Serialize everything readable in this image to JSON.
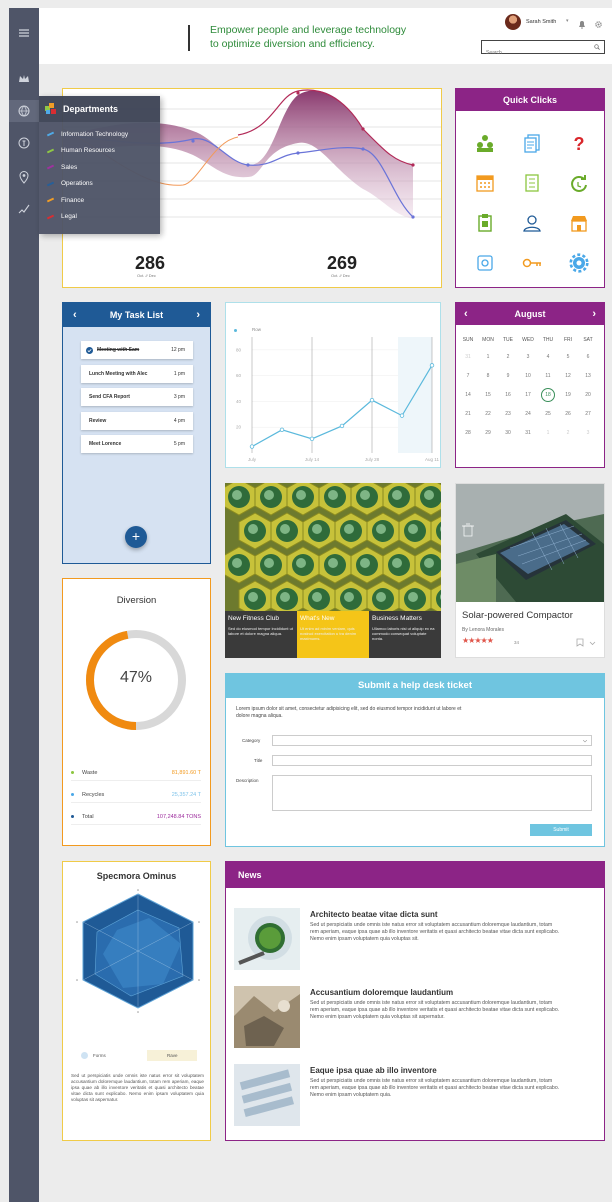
{
  "header": {
    "tagline_line1": "Empower people and leverage technology",
    "tagline_line2": "to optimize diversion and efficiency.",
    "user_name": "Sarah Smith",
    "user_caret": "▾",
    "search_placeholder": "Search"
  },
  "departments": {
    "title": "Departments",
    "items": [
      {
        "label": "Information Technology",
        "color": "#4aa8e8"
      },
      {
        "label": "Human Resources",
        "color": "#8cc63f"
      },
      {
        "label": "Sales",
        "color": "#9c2a9c"
      },
      {
        "label": "Operations",
        "color": "#1f5a96"
      },
      {
        "label": "Finance",
        "color": "#f29a1f"
      },
      {
        "label": "Legal",
        "color": "#d9262b"
      }
    ]
  },
  "top_chart": {
    "stat1_value": "286",
    "stat1_label": "Oct. // Dec",
    "stat2_value": "269",
    "stat2_label": "Oct. // Dec"
  },
  "quick_clicks": {
    "title": "Quick Clicks",
    "icons": [
      "people-icon",
      "document-icon",
      "help-icon",
      "calendar-icon",
      "checklist-icon",
      "refresh-icon",
      "clipboard-icon",
      "user-icon",
      "store-icon",
      "square-icon",
      "key-icon",
      "gear-icon"
    ]
  },
  "tasks": {
    "title": "My Task List",
    "prev": "‹",
    "next": "›",
    "items": [
      {
        "label": "Meeting with Sam",
        "time": "12 pm",
        "done": true
      },
      {
        "label": "Lunch Meeting with Alec",
        "time": "1 pm",
        "done": false
      },
      {
        "label": "Send CFA Report",
        "time": "3 pm",
        "done": false
      },
      {
        "label": "Review",
        "time": "4 pm",
        "done": false
      },
      {
        "label": "Meet Lorence",
        "time": "5 pm",
        "done": false
      }
    ],
    "add": "+"
  },
  "line_chart": {
    "legend_label": "Row"
  },
  "chart_data": {
    "type": "line",
    "x": [
      "July",
      "July 14",
      "July 28",
      "Aug 11"
    ],
    "series": [
      {
        "name": "Row",
        "values": [
          5,
          18,
          11,
          21,
          41,
          29,
          68
        ]
      }
    ],
    "yticks": [
      "80",
      "60",
      "40",
      "20"
    ],
    "ylim": [
      0,
      90
    ],
    "grid": true,
    "legend_position": "top-left"
  },
  "calendar": {
    "month": "August",
    "prev": "‹",
    "next": "›",
    "weekdays": [
      "SUN",
      "MON",
      "TUE",
      "WED",
      "THU",
      "FRI",
      "SAT"
    ],
    "weeks": [
      [
        "31",
        "1",
        "2",
        "3",
        "4",
        "5",
        "6"
      ],
      [
        "7",
        "8",
        "9",
        "10",
        "11",
        "12",
        "13"
      ],
      [
        "14",
        "15",
        "16",
        "17",
        "18",
        "19",
        "20"
      ],
      [
        "21",
        "22",
        "23",
        "24",
        "25",
        "26",
        "27"
      ],
      [
        "28",
        "29",
        "30",
        "31",
        "1",
        "2",
        "3"
      ]
    ],
    "selected": "18"
  },
  "features": [
    {
      "title": "New Fitness Club",
      "text": "Sed do eiusmod tempor incididunt ut labore et dolore magna aliqua."
    },
    {
      "title": "What's New",
      "text": "Ut enim ad minim veniam, quis nostrud exercitation u tra denim maximums."
    },
    {
      "title": "Business Matters",
      "text": "Ullamco laboris nisi ut aliquip ex ea commodo consequat voluptate nonta."
    }
  ],
  "product": {
    "title": "Solar-powered Compactor",
    "author": "By Lenora Morales",
    "rating": 4.5,
    "rating_count": "34"
  },
  "diversion": {
    "title": "Diversion",
    "percent_label": "47%",
    "percent": 0.47,
    "rows": [
      {
        "label": "Waste",
        "value": "81,891.60 T",
        "color": "#8cc63f",
        "value_color": "#f29a1f"
      },
      {
        "label": "Recycles",
        "value": "25,357.24 T",
        "color": "#4aa8e8",
        "value_color": "#7fc3ea"
      },
      {
        "label": "Total",
        "value": "107,248.84 TONS",
        "color": "#1f5a96",
        "value_color": "#9c2a9c"
      }
    ]
  },
  "help": {
    "title": "Submit a help desk ticket",
    "intro": "Lorem ipsum dolor sit amet, consectetur adipisicing elit, sed do eiusmod tempor incididunt ut labore et dolore magna aliqua.",
    "category_label": "Category",
    "title_label": "Title",
    "description_label": "Description",
    "submit": "Submit"
  },
  "radar": {
    "title": "Specmora Ominus",
    "legend1": "Forms",
    "legend2": "Rave",
    "text": "Sed ut perspiciatis unde omnis iste natus error sit voluptatem accusantium doloremque laudantium, totam rem aperiam, eaque ipsa quae ab illo inventore veritatis et quasi architecto beatae vitae dicta sunt explicabo. Nemo enim ipsam voluptatem quia voluptas sit aspernatur."
  },
  "news": {
    "title": "News",
    "items": [
      {
        "title": "Architecto beatae vitae dicta sunt",
        "body": "Sed ut perspiciatis unde omnis iste natus error sit voluptatem accusantium doloremque laudantium, totam rem aperiam, eaque ipsa quae ab illo inventore veritatis et quasi architecto beatae vitae dicta sunt explicabo. Nemo enim ipsam voluptatem quia voluptas sit."
      },
      {
        "title": "Accusantium doloremque laudantium",
        "body": "Sed ut perspiciatis unde omnis iste natus error sit voluptatem accusantium doloremque laudantium, totam rem aperiam, eaque ipsa quae ab illo inventore veritatis et quasi architecto beatae vitae dicta sunt explicabo. Nemo enim ipsam voluptatem quia voluptas sit aspernatur."
      },
      {
        "title": "Eaque ipsa quae ab illo inventore",
        "body": "Sed ut perspiciatis unde omnis iste natus error sit voluptatem accusantium doloremque laudantium, totam rem aperiam, eaque ipsa quae ab illo inventore veritatis et quasi architecto beatae vitae dicta sunt explicabo. Nemo enim ipsam voluptatem quia."
      }
    ]
  }
}
